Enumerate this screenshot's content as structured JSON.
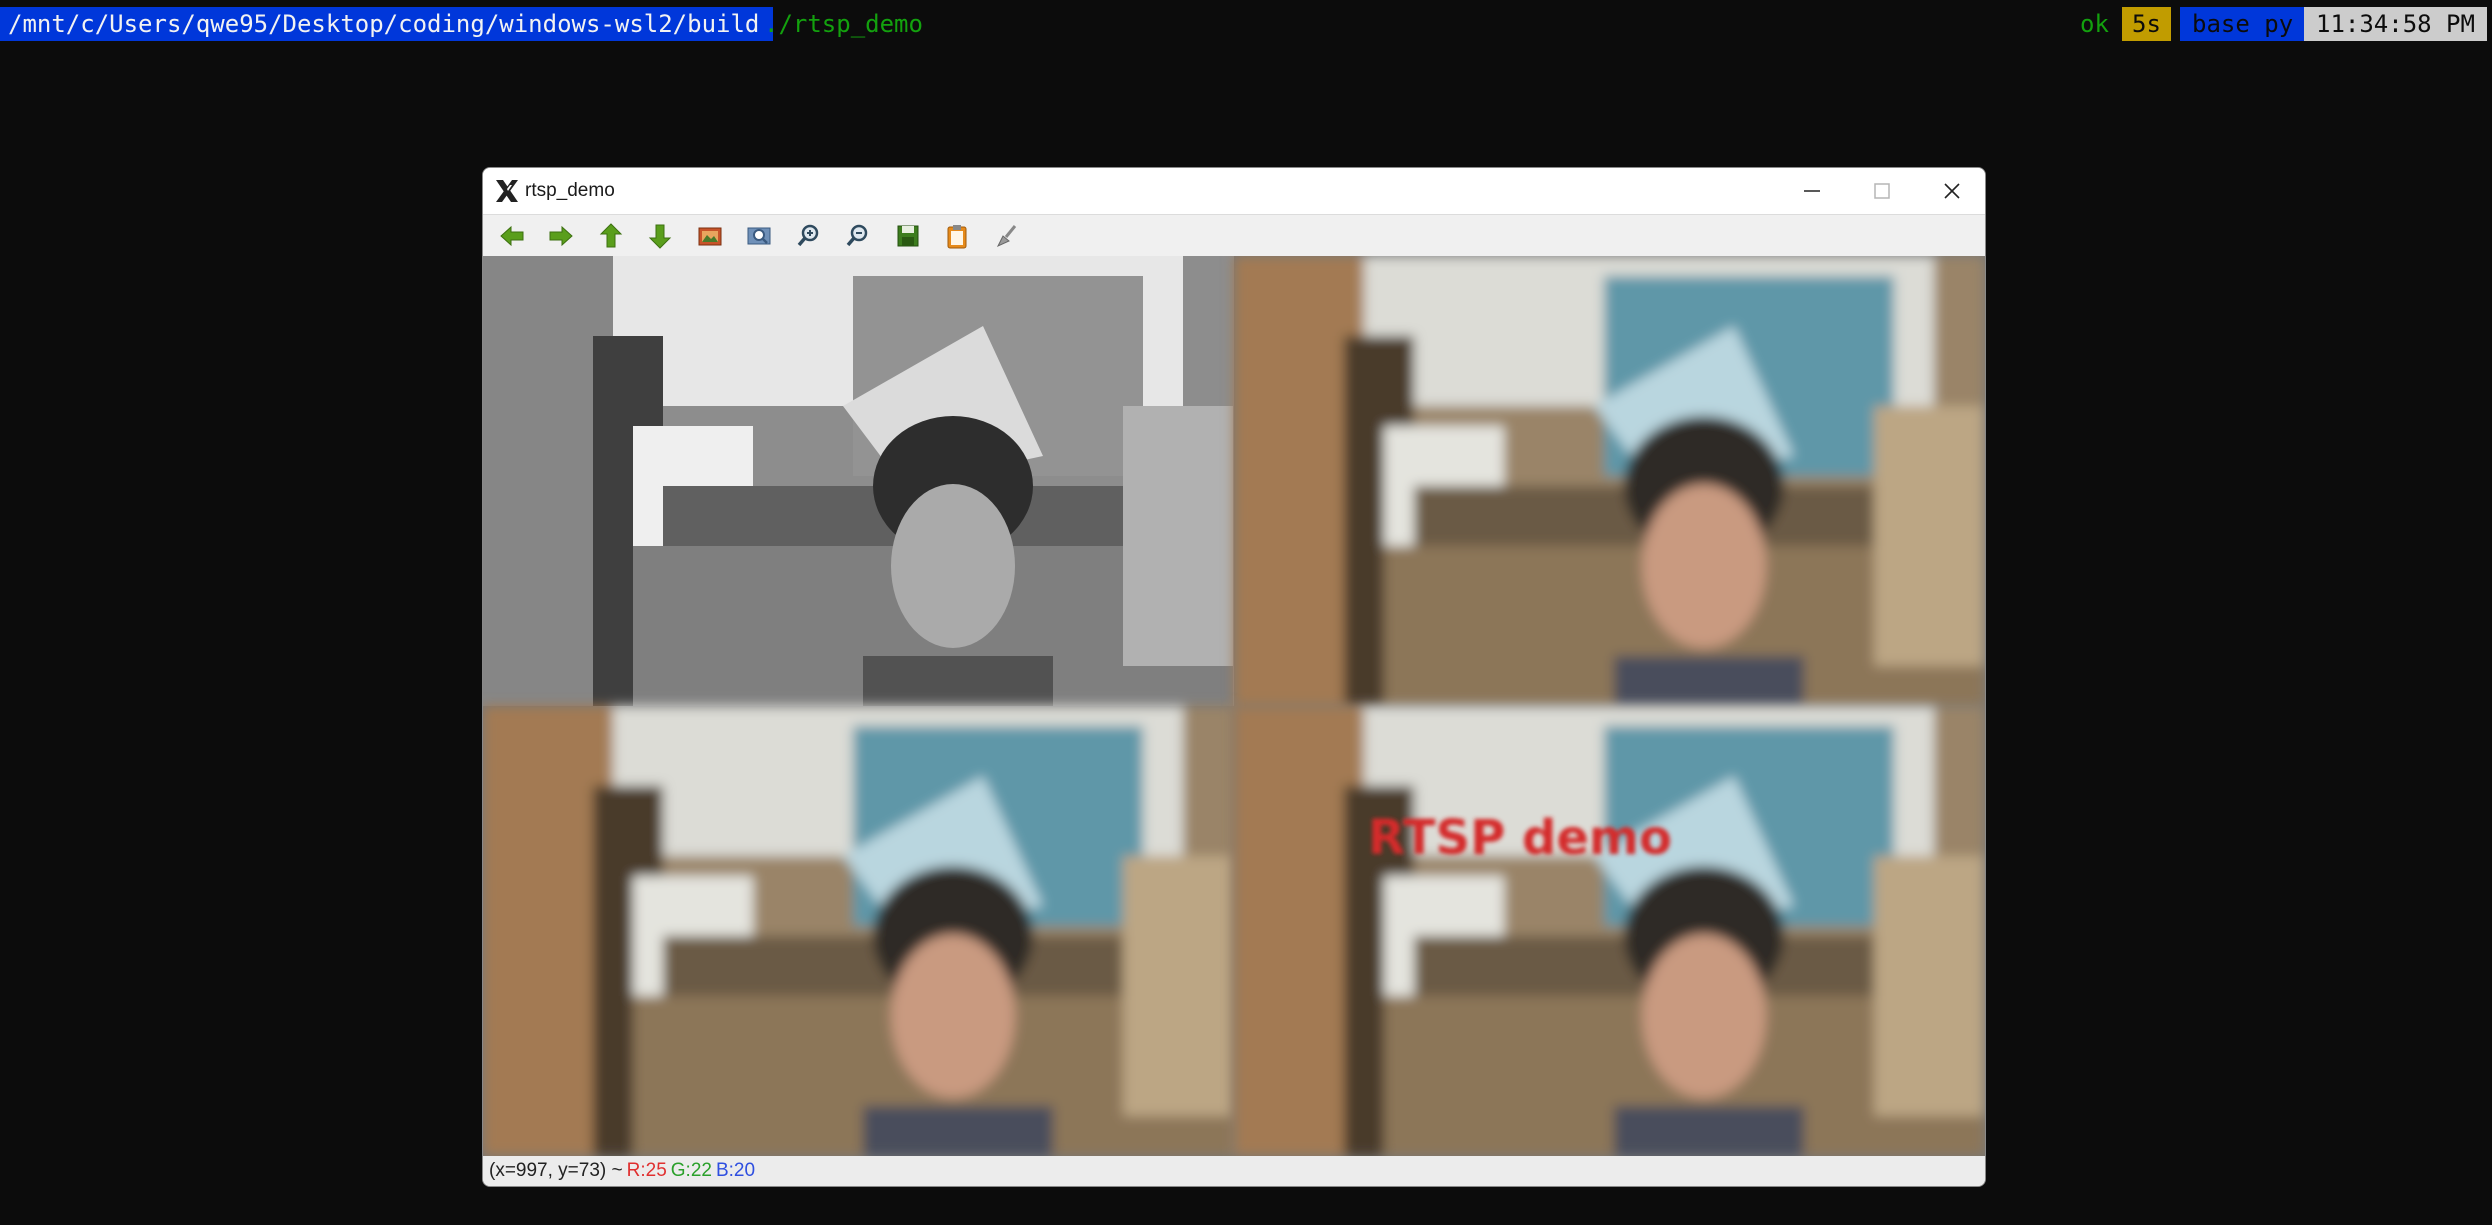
{
  "terminal": {
    "cwd": "/mnt/c/Users/qwe95/Desktop/coding/windows-wsl2/build",
    "command": "./rtsp_demo",
    "status_ok": "ok",
    "duration": "5s",
    "env": "base py",
    "clock": "11:34:58 PM"
  },
  "window": {
    "title": "rtsp_demo",
    "toolbar": [
      {
        "name": "back-arrow-icon"
      },
      {
        "name": "forward-arrow-icon"
      },
      {
        "name": "up-arrow-icon"
      },
      {
        "name": "down-arrow-icon"
      },
      {
        "name": "image-icon"
      },
      {
        "name": "zoom-fit-icon"
      },
      {
        "name": "zoom-in-icon"
      },
      {
        "name": "zoom-out-icon"
      },
      {
        "name": "save-icon"
      },
      {
        "name": "clipboard-icon"
      },
      {
        "name": "brush-icon"
      }
    ],
    "overlay_text": "RTSP demo",
    "status": {
      "coords": "(x=997, y=73) ~",
      "r": "R:25",
      "g": "G:22",
      "b": "B:20"
    }
  },
  "colors": {
    "terminal_bg": "#0c0c0c",
    "path_bg": "#0037da",
    "command_green": "#13a10e",
    "duration_bg": "#c19c00",
    "clock_bg": "#cccccc",
    "overlay_red": "#d42a2a"
  }
}
